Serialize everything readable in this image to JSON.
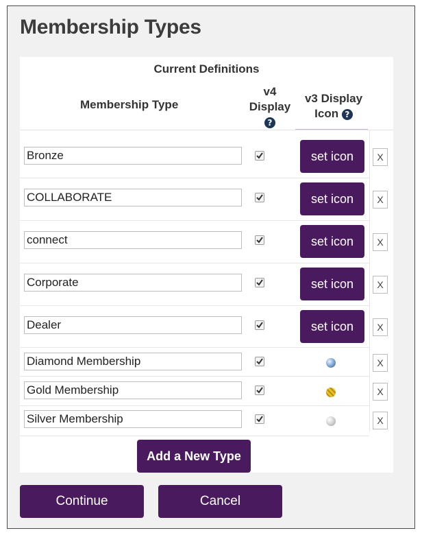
{
  "page": {
    "title": "Membership Types"
  },
  "table": {
    "caption": "Current Definitions",
    "col_type": "Membership Type",
    "col_v4_line1": "v4",
    "col_v4_line2": "Display",
    "col_v3_line1": "v3 Display",
    "col_v3_line2": "Icon",
    "help_glyph": "?"
  },
  "rows": [
    {
      "name": "Bronze",
      "v4_display": true,
      "icon": "set icon"
    },
    {
      "name": "COLLABORATE",
      "v4_display": true,
      "icon": "set icon"
    },
    {
      "name": "connect",
      "v4_display": true,
      "icon": "set icon"
    },
    {
      "name": "Corporate",
      "v4_display": true,
      "icon": "set icon"
    },
    {
      "name": "Dealer",
      "v4_display": true,
      "icon": "set icon"
    },
    {
      "name": "Diamond Membership",
      "v4_display": true,
      "icon_name": "diamond-badge-icon"
    },
    {
      "name": "Gold Membership",
      "v4_display": true,
      "icon_name": "gold-badge-icon"
    },
    {
      "name": "Silver Membership",
      "v4_display": true,
      "icon_name": "silver-badge-icon"
    }
  ],
  "delete_label": "X",
  "add_label": "Add a New Type",
  "footer": {
    "continue_label": "Continue",
    "cancel_label": "Cancel"
  },
  "colors": {
    "accent": "#4a1a5e",
    "help_icon": "#1d3557",
    "frame_bg": "#f1f1f1"
  }
}
